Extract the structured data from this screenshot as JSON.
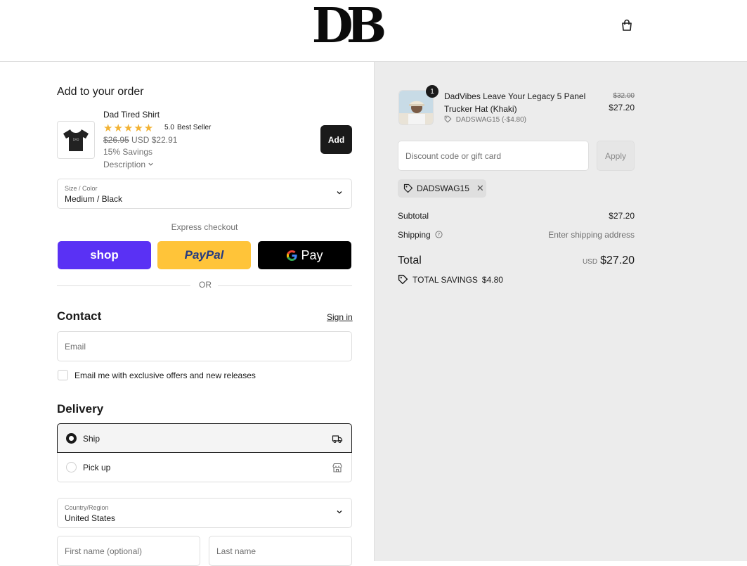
{
  "header": {
    "logo_text": "DB",
    "cart_icon": "shopping-bag-icon"
  },
  "upsell": {
    "heading": "Add to your order",
    "product": {
      "title": "Dad Tired Shirt",
      "rating_stars": 5,
      "stars": "★★★★★",
      "rating": "5.0",
      "badge": "Best Seller",
      "original_price": "$26.95",
      "currency": "USD",
      "price": "$22.91",
      "savings": "15% Savings",
      "description_link": "Description",
      "add_label": "Add"
    },
    "variant": {
      "label": "Size / Color",
      "value": "Medium / Black"
    }
  },
  "express": {
    "label": "Express checkout",
    "shop_label": "shop",
    "paypal_label": "PayPal",
    "gpay_label": "Pay",
    "or_label": "OR"
  },
  "contact": {
    "heading": "Contact",
    "signin_label": "Sign in",
    "email_placeholder": "Email",
    "marketing_label": "Email me with exclusive offers and new releases",
    "marketing_checked": false
  },
  "delivery": {
    "heading": "Delivery",
    "options": [
      {
        "label": "Ship",
        "selected": true,
        "icon": "truck-icon"
      },
      {
        "label": "Pick up",
        "selected": false,
        "icon": "store-icon"
      }
    ],
    "country_label": "Country/Region",
    "country_value": "United States",
    "first_name_placeholder": "First name (optional)",
    "last_name_placeholder": "Last name"
  },
  "summary": {
    "item": {
      "quantity": "1",
      "title": "DadVibes Leave Your Legacy 5 Panel Trucker Hat (Khaki)",
      "discount_tag": "DADSWAG15 (-$4.80)",
      "original_price": "$32.00",
      "price": "$27.20"
    },
    "discount_placeholder": "Discount code or gift card",
    "apply_label": "Apply",
    "applied_code": "DADSWAG15",
    "subtotal_label": "Subtotal",
    "subtotal_value": "$27.20",
    "shipping_label": "Shipping",
    "shipping_value": "Enter shipping address",
    "total_label": "Total",
    "total_currency": "USD",
    "total_value": "$27.20",
    "total_savings_label": "TOTAL SAVINGS",
    "total_savings_value": "$4.80"
  },
  "colors": {
    "shop": "#5a31f4",
    "paypal": "#ffc439",
    "gpay": "#000000",
    "star": "#f2b233"
  }
}
